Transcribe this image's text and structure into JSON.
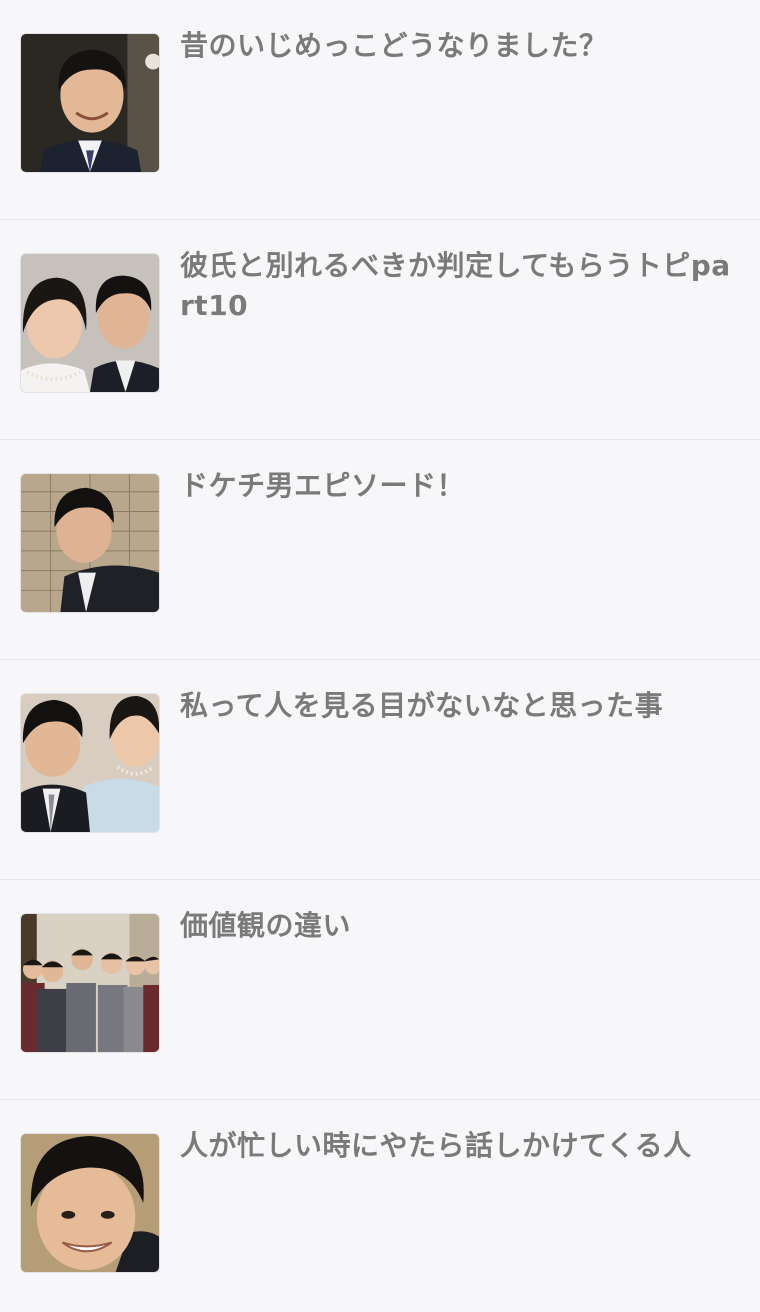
{
  "topics": [
    {
      "title": "昔のいじめっこどうなりました？",
      "thumbnail": "photo-man-suit-smiling"
    },
    {
      "title": "彼氏と別れるべきか判定してもらうトピpart10",
      "thumbnail": "photo-woman-and-man-formal"
    },
    {
      "title": "ドケチ男エピソード！",
      "thumbnail": "photo-man-suit-brick-wall"
    },
    {
      "title": "私って人を見る目がないなと思った事",
      "thumbnail": "photo-man-and-woman-pearls"
    },
    {
      "title": "価値観の違い",
      "thumbnail": "photo-family-group"
    },
    {
      "title": "人が忙しい時にやたら話しかけてくる人",
      "thumbnail": "photo-man-closeup-smiling"
    }
  ]
}
